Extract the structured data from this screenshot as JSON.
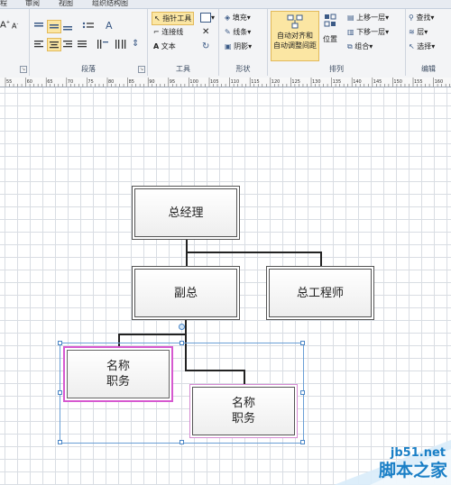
{
  "ribbon": {
    "tabs": [
      "程",
      "审阅",
      "视图",
      "组织结构图"
    ],
    "paragraph": {
      "label": "段落"
    },
    "tools": {
      "label": "工具",
      "pointer": "指针工具",
      "connector": "连接线",
      "text": "文本"
    },
    "shape": {
      "label": "形状",
      "fill": "填充",
      "line": "线条",
      "shadow": "阴影"
    },
    "arrange": {
      "label": "排列",
      "auto_align_1": "自动对齐和",
      "auto_align_2": "自动调整间距",
      "position": "位置",
      "bring_forward": "上移一层",
      "send_backward": "下移一层",
      "group": "组合"
    },
    "edit": {
      "label": "编辑",
      "find": "查找",
      "layer": "层",
      "select": "选择"
    }
  },
  "ruler": {
    "ticks": [
      "55",
      "60",
      "65",
      "70",
      "75",
      "80",
      "85",
      "90",
      "95",
      "100",
      "105",
      "110",
      "115",
      "120",
      "125",
      "130",
      "135",
      "140",
      "145",
      "150",
      "155",
      "160"
    ]
  },
  "chart": {
    "ceo": "总经理",
    "vp": "副总",
    "chief_engineer": "总工程师",
    "staff1_name": "名称",
    "staff1_title": "职务",
    "staff2_name": "名称",
    "staff2_title": "职务"
  },
  "watermark": {
    "url": "jb51.net",
    "name": "脚本之家"
  },
  "colors": {
    "selected_outline": "#d659d0",
    "handle": "#4a86c6",
    "tool_highlight": "#fbe6a3"
  }
}
